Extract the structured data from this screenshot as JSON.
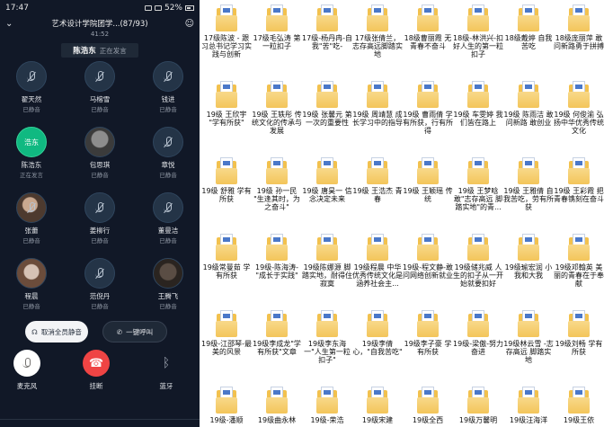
{
  "status": {
    "time": "17:47",
    "battery": "52%"
  },
  "call": {
    "title": "艺术设计学院团学...(87/93)",
    "duration": "41:52",
    "speaker_name": "陈浩东",
    "speaker_state": "正在发言"
  },
  "participants": [
    {
      "name": "翟天然",
      "status": "已静音"
    },
    {
      "name": "马榕雪",
      "status": "已静音"
    },
    {
      "name": "钱进",
      "status": "已静音"
    },
    {
      "name": "陈浩东",
      "status": "正在发言",
      "avatar_text": "浩东"
    },
    {
      "name": "包思琪",
      "status": "已静音"
    },
    {
      "name": "章悦",
      "status": "已静音"
    },
    {
      "name": "张蕾",
      "status": "已静音"
    },
    {
      "name": "姜柳行",
      "status": "已静音"
    },
    {
      "name": "董曼洁",
      "status": "已静音"
    },
    {
      "name": "程晨",
      "status": "已静音"
    },
    {
      "name": "范倪丹",
      "status": "已静音"
    },
    {
      "name": "王腾飞",
      "status": "已静音"
    }
  ],
  "actions": {
    "mute_all": "取消全员静音",
    "call_all": "一键呼叫"
  },
  "controls": {
    "mic": "麦克风",
    "hangup": "挂断",
    "bluetooth": "蓝牙"
  },
  "files": [
    "17级陈波 - 跟习总书记学习实践与创新",
    "17级毛弘涛 第一粒扣子",
    "17级-杨丹冉-自我\"苦\"吃-",
    "17级张倩兰，志存高远脚踏实地",
    "18级曹丽霞 无青春不奋斗",
    "18级-林洪兴-扣好人生的第一粒扣子",
    "18级戴婷 自我苦吃",
    "18级庞丽萍 敢问新路勇于拼搏",
    "19级 王欣宇 \"学有所获\"",
    "19级 王轶彤 传统文化的传承与发展",
    "19级 张馨元 第一次的重要性",
    "19级 周靖慧 成长学习中的指导",
    "19级 曹雨倩 学有所获，行有所得",
    "19级 车雯婷 我们皆在路上",
    "19级 陈雨洁 敢问新路 敢创业",
    "19级 何俊渝 弘扬中华优秀传统文化",
    "19级 舒雅 学有所获",
    "19级 孙一民 \"生逢其时，为之奋斗\"",
    "19级 唐昊一 信念决定未来",
    "19级 王浩杰 青春",
    "19级 王颖瑶 传统",
    "19级 王梦晗 敢\"志存高远 脚踏实地\"的青...",
    "19级 王雅倩 自我苦吃，劳有所获",
    "19级 王彩霞 把青春镌刻在奋斗",
    "19级常曼茹 学有所获",
    "19级-陈海涛-\"成长于实践\"",
    "19级陈娜源 脚踏实地，耐得住寂寞",
    "19级程晨 中华优秀传统文化是涵养社会主...",
    "19级-程文静-敢问网络创新就业",
    "19级储兆威 人生的扣子从一开始就要扣好",
    "19级瑜宏润 小我和大我",
    "19级邓翰英 美丽的青春在于奉献",
    "19级-江邵琴-最美的风景",
    "19级李成龙\"学有所获\"文章",
    "19级李东海一\"人生第一粒扣子\"",
    "19级李倩心，\"自我苦吃\"",
    "19级李子豪 学有所获",
    "19级-梁傲-努力 奋进",
    "19级林云雪 -志存高远 脚踏实地",
    "19级刘畅 学有所获",
    "19级-潘顺",
    "19级曲永林",
    "19级-荣浩",
    "19级宋建",
    "19级全西",
    "19级万馨明",
    "19级汪海洋",
    "19级王依"
  ]
}
